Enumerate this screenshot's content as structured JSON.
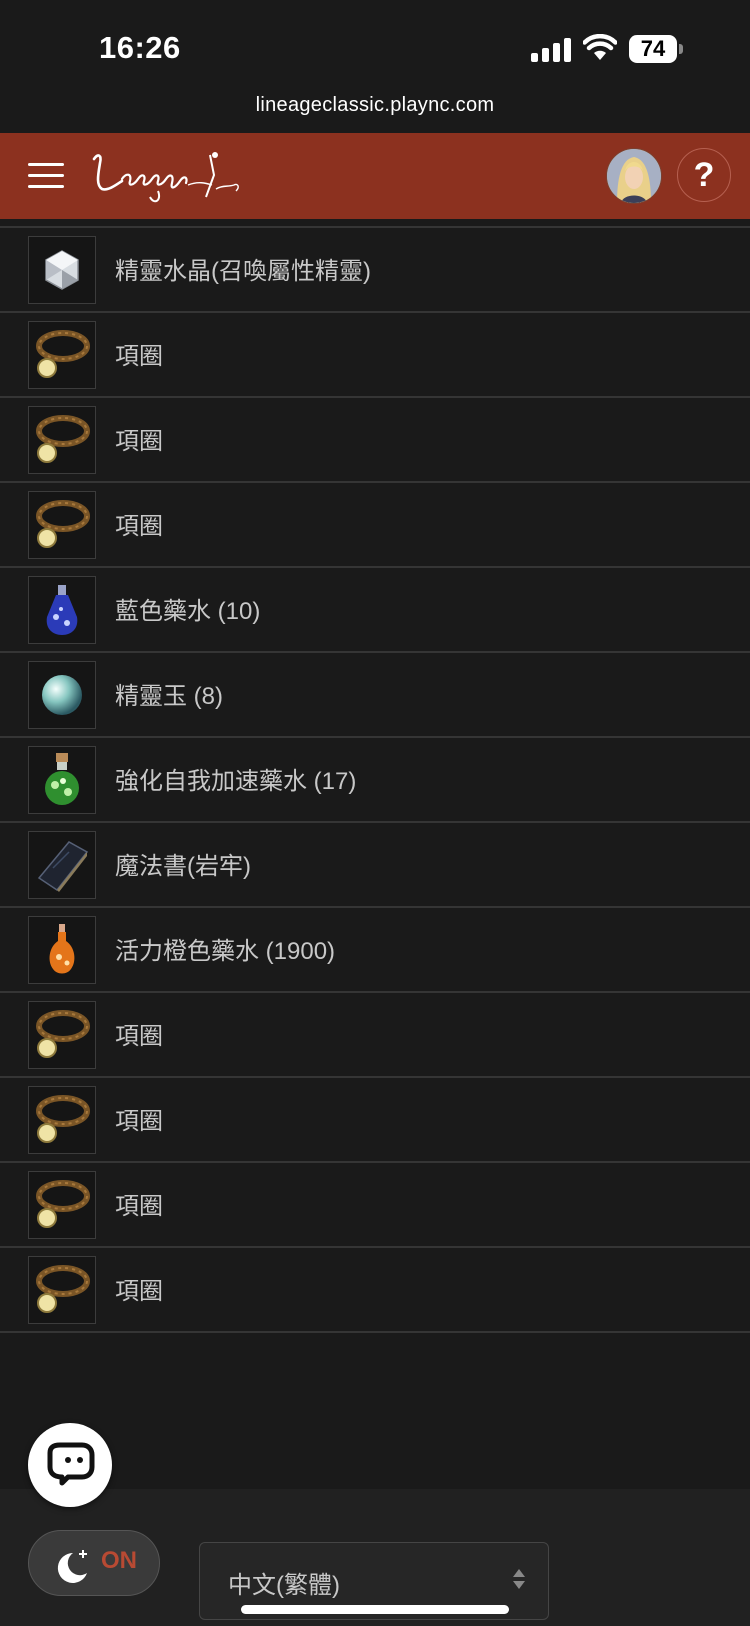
{
  "status": {
    "time": "16:26",
    "battery": "74"
  },
  "browser": {
    "url": "lineageclassic.plaync.com"
  },
  "header": {
    "logo_alt": "Lineage Classic",
    "help": "?"
  },
  "items": [
    {
      "label": "精靈水晶(召喚屬性精靈)",
      "icon": "crystal-icon"
    },
    {
      "label": "項圈",
      "icon": "collar-icon"
    },
    {
      "label": "項圈",
      "icon": "collar-icon"
    },
    {
      "label": "項圈",
      "icon": "collar-icon"
    },
    {
      "label": "藍色藥水 (10)",
      "icon": "blue-potion-icon"
    },
    {
      "label": "精靈玉 (8)",
      "icon": "spirit-orb-icon"
    },
    {
      "label": "強化自我加速藥水 (17)",
      "icon": "green-potion-icon"
    },
    {
      "label": "魔法書(岩牢)",
      "icon": "spellbook-icon"
    },
    {
      "label": "活力橙色藥水 (1900)",
      "icon": "orange-potion-icon"
    },
    {
      "label": "項圈",
      "icon": "collar-icon"
    },
    {
      "label": "項圈",
      "icon": "collar-icon"
    },
    {
      "label": "項圈",
      "icon": "collar-icon"
    },
    {
      "label": "項圈",
      "icon": "collar-icon"
    }
  ],
  "footer": {
    "theme_toggle": "ON",
    "language": "中文(繁體)"
  }
}
